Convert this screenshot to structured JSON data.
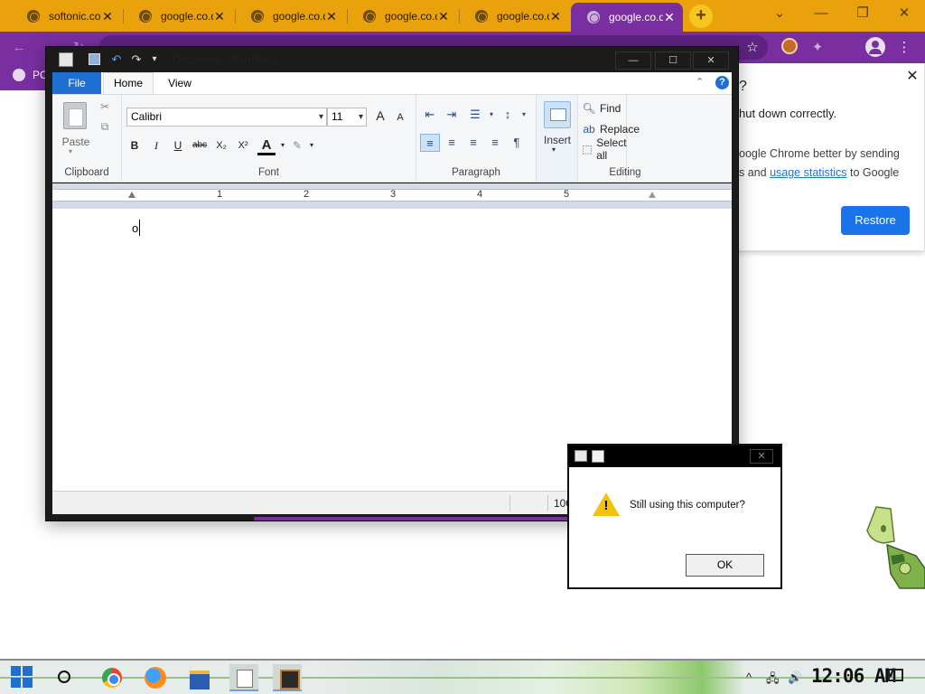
{
  "browser": {
    "tabs": [
      {
        "title": "softonic.co",
        "active": false
      },
      {
        "title": "google.co.d",
        "active": false
      },
      {
        "title": "google.co.d",
        "active": false
      },
      {
        "title": "google.co.d",
        "active": false
      },
      {
        "title": "google.co.d",
        "active": false
      },
      {
        "title": "google.co.d",
        "active": true
      }
    ],
    "new_tab_label": "+",
    "window_controls": {
      "tab_search": "⌄",
      "minimize": "—",
      "restore": "❐",
      "close": "✕"
    },
    "toolbar": {
      "back_icon": "←",
      "reload_icon": "↻",
      "star_icon": "☆",
      "extensions_icon": "✦",
      "menu_icon": "⋮"
    },
    "bookmark": {
      "label": "PC"
    },
    "colors": {
      "tab_strip": "#e9a20c",
      "active_tab": "#7a2fa0",
      "toolbar": "#7a2fa0",
      "accent_button": "#1a73e8"
    },
    "restore_bubble": {
      "title_fragment": "?",
      "close_label": "✕",
      "message": "hut down correctly.",
      "desc_line1": "oogle Chrome better by sending",
      "desc_line2_prefix": "s and ",
      "desc_link": "usage statistics",
      "desc_line2_suffix": " to Google",
      "restore_label": "Restore"
    }
  },
  "wordpad": {
    "title": "Document - WordPad",
    "quick_access": {
      "save_icon": "💾",
      "undo_icon": "↶",
      "redo_icon": "↷",
      "customize_icon": "▾"
    },
    "window_controls": {
      "minimize": "—",
      "maximize": "☐",
      "close": "✕"
    },
    "tabs": {
      "file": "File",
      "home": "Home",
      "view": "View"
    },
    "ribbon_collapse_icon": "⌃",
    "help_label": "?",
    "clipboard": {
      "paste_label": "Paste",
      "paste_arrow": "▾",
      "cut_icon": "✂",
      "copy_icon": "⧉",
      "group_label": "Clipboard"
    },
    "font": {
      "family": "Calibri",
      "size": "11",
      "grow_label": "A",
      "shrink_label": "A",
      "bold": "B",
      "italic": "I",
      "underline": "U",
      "strike": "abc",
      "subscript": "X₂",
      "superscript": "X²",
      "color_label": "A",
      "highlight_icon": "✎",
      "group_label": "Font"
    },
    "paragraph": {
      "decrease_indent_icon": "⇤",
      "increase_indent_icon": "⇥",
      "bullets_icon": "☰",
      "line_spacing_icon": "↕",
      "align_left_icon": "≡",
      "align_center_icon": "≡",
      "align_right_icon": "≡",
      "justify_icon": "≡",
      "rtl_icon": "¶",
      "group_label": "Paragraph"
    },
    "insert": {
      "label": "Insert",
      "arrow": "▾"
    },
    "editing": {
      "find": "Find",
      "replace": "Replace",
      "select_all": "Select all",
      "group_label": "Editing"
    },
    "ruler": {
      "numbers": [
        "1",
        "2",
        "3",
        "4",
        "5"
      ]
    },
    "document": {
      "text": "o"
    },
    "status": {
      "zoom": "100%"
    }
  },
  "alert": {
    "message": "Still using this computer?",
    "ok_label": "OK",
    "close_label": "✕",
    "warn_mark": "!"
  },
  "taskbar": {
    "clock": "12:06 AM",
    "tray": {
      "chevron_icon": "^",
      "network_icon": "🖧",
      "volume_icon": "🔊"
    }
  }
}
